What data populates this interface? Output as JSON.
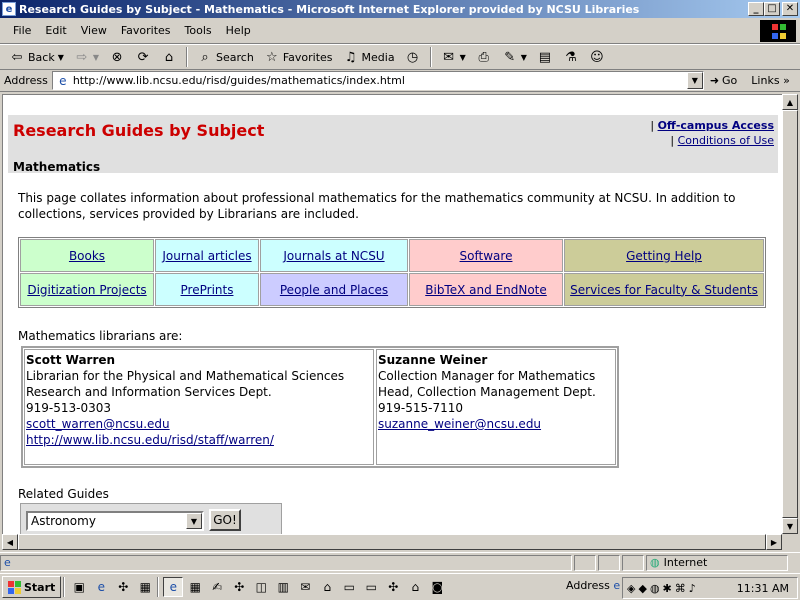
{
  "window": {
    "title": "Research Guides by Subject - Mathematics - Microsoft Internet Explorer provided by NCSU Libraries",
    "min": "_",
    "max": "□",
    "close": "✕"
  },
  "menu": [
    "File",
    "Edit",
    "View",
    "Favorites",
    "Tools",
    "Help"
  ],
  "toolbar": {
    "back": "Back",
    "search": "Search",
    "favorites": "Favorites",
    "media": "Media"
  },
  "address": {
    "label": "Address",
    "url": "http://www.lib.ncsu.edu/risd/guides/mathematics/index.html",
    "go": "Go",
    "links": "Links"
  },
  "page": {
    "title": "Research Guides by Subject",
    "subtitle": "Mathematics",
    "offcampus": "Off-campus Access",
    "conditions": "Conditions of Use",
    "intro": "This page collates information about professional mathematics for the mathematics community at NCSU. In addition to collections, services provided by Librarians are included.",
    "grid": [
      [
        {
          "label": "Books",
          "color": "#ccffcc"
        },
        {
          "label": "Journal articles",
          "color": "#ccffff"
        },
        {
          "label": "Journals at NCSU",
          "color": "#ccffff"
        },
        {
          "label": "Software",
          "color": "#ffcccc"
        },
        {
          "label": "Getting Help",
          "color": "#cccc99"
        }
      ],
      [
        {
          "label": "Digitization Projects",
          "color": "#ccffcc"
        },
        {
          "label": "PrePrints",
          "color": "#ccffff"
        },
        {
          "label": "People and Places",
          "color": "#ccccff"
        },
        {
          "label": "BibTeX and EndNote",
          "color": "#ffcccc"
        },
        {
          "label": "Services for Faculty & Students",
          "color": "#cccc99"
        }
      ]
    ],
    "librarians_label": "Mathematics librarians are:",
    "librarians": [
      {
        "name": "Scott Warren",
        "title": "Librarian for the Physical and Mathematical Sciences",
        "dept": "Research and Information Services Dept.",
        "phone": "919-513-0303",
        "email": "scott_warren@ncsu.edu",
        "url": "http://www.lib.ncsu.edu/risd/staff/warren/"
      },
      {
        "name": "Suzanne Weiner",
        "title": "Collection Manager for Mathematics",
        "dept": "Head, Collection Management Dept.",
        "phone": "919-515-7110",
        "email": "suzanne_weiner@ncsu.edu",
        "url": ""
      }
    ],
    "related_label": "Related Guides",
    "related_selected": "Astronomy",
    "go_button": "GO!"
  },
  "status": {
    "zone": "Internet"
  },
  "taskbar": {
    "start": "Start",
    "address": "Address",
    "clock": "11:31 AM"
  }
}
